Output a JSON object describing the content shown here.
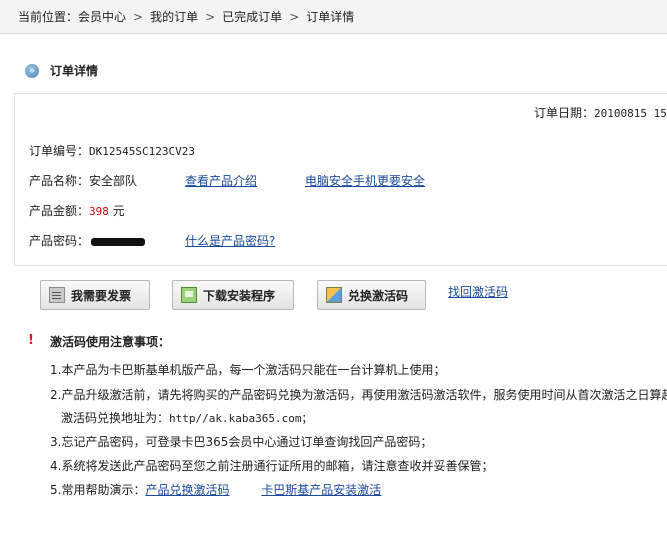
{
  "breadcrumb": {
    "prefix": "当前位置：",
    "items": [
      "会员中心",
      "我的订单",
      "已完成订单",
      "订单详情"
    ],
    "separator": ">"
  },
  "page_title": "订单详情",
  "order": {
    "date_label": "订单日期：",
    "date_value": "20100815 15",
    "number_label": "订单编号：",
    "number_value": "DK12545SC123CV23",
    "product_name_label": "产品名称：",
    "product_name_value": "安全部队",
    "view_intro_link": "查看产品介绍",
    "pc_safe_link": "电脑安全手机更要安全",
    "amount_label": "产品金额：",
    "amount_value": "398",
    "amount_unit": "元",
    "password_label": "产品密码：",
    "what_is_password_link": "什么是产品密码?"
  },
  "actions": {
    "invoice_button": "我需要发票",
    "download_button": "下载安装程序",
    "exchange_button": "兑换激活码",
    "find_code_link": "找回激活码"
  },
  "notice": {
    "title": "激活码使用注意事项：",
    "item1": "1.本产品为卡巴斯基单机版产品，每一个激活码只能在一台计算机上使用；",
    "item2": "2.产品升级激活前，请先将购买的产品密码兑换为激活码，再使用激活码激活软件，服务使用时间从首次激活之日算起",
    "item2b_prefix": "激活码兑换地址为：",
    "item2b_url": "http//ak.kaba365.com；",
    "item3": "3.忘记产品密码，可登录卡巴365会员中心通过订单查询找回产品密码；",
    "item4": "4.系统将发送此产品密码至您之前注册通行证所用的邮箱，请注意查收并妥善保管；",
    "item5_prefix": "5.常用帮助演示：",
    "item5_link1": "产品兑换激活码",
    "item5_link2": "卡巴斯基产品安装激活"
  },
  "colors": {
    "link": "#1a4a9c",
    "price": "#d40000",
    "notice_icon": "#d21e1e"
  }
}
